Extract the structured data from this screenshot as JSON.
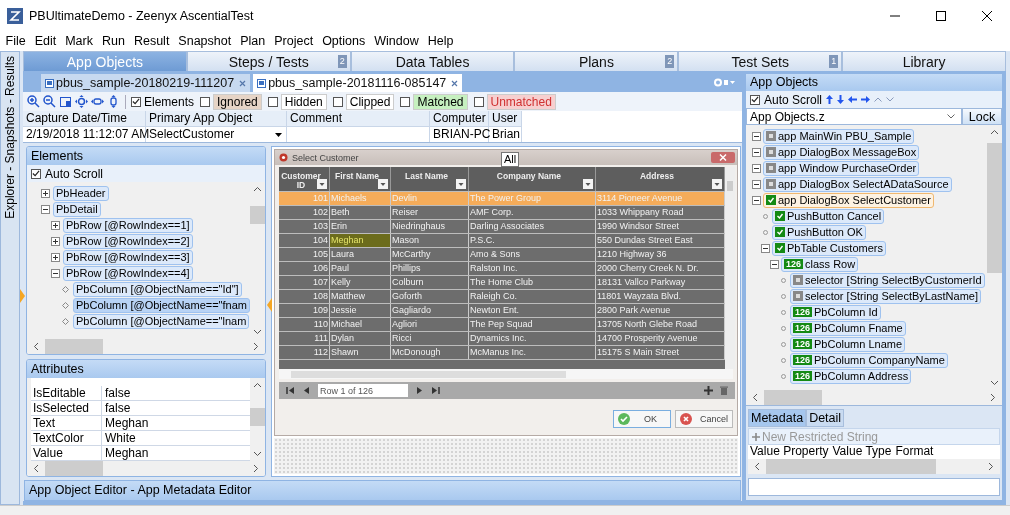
{
  "window": {
    "title": "PBUltimateDemo - Zeenyx AscentialTest"
  },
  "menu": [
    "File",
    "Edit",
    "Mark",
    "Run",
    "Result",
    "Snapshot",
    "Plan",
    "Project",
    "Options",
    "Window",
    "Help"
  ],
  "side_strip": {
    "label": "Explorer - Snapshots - Results"
  },
  "main_tabs": [
    {
      "label": "App Objects",
      "selected": true
    },
    {
      "label": "Steps / Tests",
      "selected": false,
      "badge": "2"
    },
    {
      "label": "Data Tables",
      "selected": false
    },
    {
      "label": "Plans",
      "selected": false,
      "badge": "2"
    },
    {
      "label": "Test Sets",
      "selected": false,
      "badge": "1"
    },
    {
      "label": "Library",
      "selected": false
    }
  ],
  "doc_tabs": [
    {
      "label": "pbus_sample-20180219-111207",
      "selected": false
    },
    {
      "label": "pbus_sample-20181116-085147",
      "selected": true
    }
  ],
  "filters": [
    {
      "label": "Elements",
      "checked": true
    },
    {
      "label": "Ignored",
      "checked": false,
      "color": "#e6d4c6"
    },
    {
      "label": "Hidden",
      "checked": false,
      "color": "#ffffff"
    },
    {
      "label": "Clipped",
      "checked": false,
      "color": "#ffffff"
    },
    {
      "label": "Matched",
      "checked": false,
      "color": "#c6f0c0"
    },
    {
      "label": "Unmatched",
      "checked": false,
      "color": "#f7d0d0"
    }
  ],
  "snapshot_info": [
    {
      "label": "Capture Date/Time",
      "value": "2/19/2018 11:12:07 AM",
      "kind": "text"
    },
    {
      "label": "Primary App Object",
      "value": "SelectCustomer",
      "kind": "dropdown"
    },
    {
      "label": "Comment",
      "kind": "text"
    },
    {
      "label": "Computer",
      "value": "BRIAN-PC",
      "kind": "text"
    },
    {
      "label": "User",
      "value": "Brian",
      "kind": "text"
    }
  ],
  "elements_panel": {
    "title": "Elements",
    "auto_scroll": {
      "label": "Auto Scroll",
      "checked": true
    },
    "tree": [
      {
        "label": "PbHeader",
        "expanded": false,
        "selected": false
      },
      {
        "label": "PbDetail",
        "expanded": true,
        "selected": false,
        "children": [
          {
            "label": "PbRow [@RowIndex==1]",
            "expanded": false,
            "selected": false
          },
          {
            "label": "PbRow [@RowIndex==2]",
            "expanded": false,
            "selected": false
          },
          {
            "label": "PbRow [@RowIndex==3]",
            "expanded": false,
            "selected": false
          },
          {
            "label": "PbRow [@RowIndex==4]",
            "expanded": true,
            "selected": false,
            "children": [
              {
                "label": "PbColumn [@ObjectName==\"Id\"]",
                "selected": false
              },
              {
                "label": "PbColumn [@ObjectName==\"fnam",
                "selected": true
              },
              {
                "label": "PbColumn [@ObjectName==\"lnam",
                "selected": false
              }
            ]
          }
        ]
      }
    ]
  },
  "attributes_panel": {
    "title": "Attributes",
    "rows": [
      {
        "name": "IsEditable",
        "value": "false"
      },
      {
        "name": "IsSelected",
        "value": "false"
      },
      {
        "name": "Text",
        "value": "Meghan"
      },
      {
        "name": "TextColor",
        "value": "White"
      },
      {
        "name": "Value",
        "value": "Meghan"
      }
    ]
  },
  "screenshot": {
    "title": "Select Customer",
    "tooltip": "All",
    "columns": [
      "Customer ID",
      "First Name",
      "Last Name",
      "Company Name",
      "Address"
    ],
    "rows": [
      {
        "selected": true,
        "cells": [
          {
            "text": "101",
            "marked": false
          },
          {
            "text": "Michaels",
            "marked": false
          },
          {
            "text": "Devlin",
            "marked": false
          },
          {
            "text": "The Power Group",
            "marked": false
          },
          {
            "text": "3114 Pioneer Avenue",
            "marked": false
          }
        ]
      },
      {
        "selected": false,
        "cells": [
          {
            "text": "102",
            "marked": false
          },
          {
            "text": "Beth",
            "marked": false
          },
          {
            "text": "Reiser",
            "marked": false
          },
          {
            "text": "AMF Corp.",
            "marked": false
          },
          {
            "text": "1033 Whippany Road",
            "marked": false
          }
        ]
      },
      {
        "selected": false,
        "cells": [
          {
            "text": "103",
            "marked": false
          },
          {
            "text": "Erin",
            "marked": false
          },
          {
            "text": "Niedringhaus",
            "marked": false
          },
          {
            "text": "Darling Associates",
            "marked": false
          },
          {
            "text": "1990 Windsor Street",
            "marked": false
          }
        ]
      },
      {
        "selected": false,
        "cells": [
          {
            "text": "104",
            "marked": false
          },
          {
            "text": "Meghan",
            "marked": true
          },
          {
            "text": "Mason",
            "marked": false
          },
          {
            "text": "P.S.C.",
            "marked": false
          },
          {
            "text": "550 Dundas Street East",
            "marked": false
          }
        ]
      },
      {
        "selected": false,
        "cells": [
          {
            "text": "105",
            "marked": false
          },
          {
            "text": "Laura",
            "marked": false
          },
          {
            "text": "McCarthy",
            "marked": false
          },
          {
            "text": "Amo & Sons",
            "marked": false
          },
          {
            "text": "1210 Highway 36",
            "marked": false
          }
        ]
      },
      {
        "selected": false,
        "cells": [
          {
            "text": "106",
            "marked": false
          },
          {
            "text": "Paul",
            "marked": false
          },
          {
            "text": "Phillips",
            "marked": false
          },
          {
            "text": "Ralston Inc.",
            "marked": false
          },
          {
            "text": "2000 Cherry Creek N. Dr.",
            "marked": false
          }
        ]
      },
      {
        "selected": false,
        "cells": [
          {
            "text": "107",
            "marked": false
          },
          {
            "text": "Kelly",
            "marked": false
          },
          {
            "text": "Colburn",
            "marked": false
          },
          {
            "text": "The Home Club",
            "marked": false
          },
          {
            "text": "18131 Vallco Parkway",
            "marked": false
          }
        ]
      },
      {
        "selected": false,
        "cells": [
          {
            "text": "108",
            "marked": false
          },
          {
            "text": "Matthew",
            "marked": false
          },
          {
            "text": "Goforth",
            "marked": false
          },
          {
            "text": "Raleigh Co.",
            "marked": false
          },
          {
            "text": "11801 Wayzata Blvd.",
            "marked": false
          }
        ]
      },
      {
        "selected": false,
        "cells": [
          {
            "text": "109",
            "marked": false
          },
          {
            "text": "Jessie",
            "marked": false
          },
          {
            "text": "Gagliardo",
            "marked": false
          },
          {
            "text": "Newton Ent.",
            "marked": false
          },
          {
            "text": "2800 Park Avenue",
            "marked": false
          }
        ]
      },
      {
        "selected": false,
        "cells": [
          {
            "text": "110",
            "marked": false
          },
          {
            "text": "Michael",
            "marked": false
          },
          {
            "text": "Agliori",
            "marked": false
          },
          {
            "text": "The Pep Squad",
            "marked": false
          },
          {
            "text": "13705 North Glebe Road",
            "marked": false
          }
        ]
      },
      {
        "selected": false,
        "cells": [
          {
            "text": "111",
            "marked": false
          },
          {
            "text": "Dylan",
            "marked": false
          },
          {
            "text": "Ricci",
            "marked": false
          },
          {
            "text": "Dynamics Inc.",
            "marked": false
          },
          {
            "text": "14700 Prosperity Avenue",
            "marked": false
          }
        ]
      },
      {
        "selected": false,
        "cells": [
          {
            "text": "112",
            "marked": false
          },
          {
            "text": "Shawn",
            "marked": false
          },
          {
            "text": "McDonough",
            "marked": false
          },
          {
            "text": "McManus Inc.",
            "marked": false
          },
          {
            "text": "15175 S Main Street",
            "marked": false
          }
        ]
      }
    ],
    "pager": {
      "value": "Row 1 of 126"
    },
    "buttons": [
      {
        "label": "OK",
        "kind": "ok"
      },
      {
        "label": "Cancel",
        "kind": "cancel"
      }
    ]
  },
  "bottom_bar": {
    "label": "App Object Editor - App Metadata Editor"
  },
  "right_panel": {
    "title": "App Objects",
    "auto_scroll": {
      "label": "Auto Scroll",
      "checked": true
    },
    "file": {
      "value": "App Objects.z"
    },
    "lock_button": "Lock",
    "tree": [
      {
        "label": "app MainWin PBU_Sample",
        "kind": "plain",
        "expanded": true,
        "selected": false
      },
      {
        "label": "app DialogBox MessageBox",
        "kind": "plain",
        "expanded": true,
        "selected": false
      },
      {
        "label": "app Window PurchaseOrder",
        "kind": "plain",
        "expanded": true,
        "selected": false
      },
      {
        "label": "app DialogBox SelectADataSource",
        "kind": "plain",
        "expanded": true,
        "selected": false
      },
      {
        "label": "app DialogBox SelectCustomer",
        "kind": "check",
        "expanded": true,
        "selected": true,
        "children": [
          {
            "label": "PushButton Cancel",
            "kind": "check",
            "selected": false
          },
          {
            "label": "PushButton OK",
            "kind": "check",
            "selected": false
          },
          {
            "label": "PbTable Customers",
            "kind": "check",
            "expanded": true,
            "selected": false,
            "children": [
              {
                "label": "class Row",
                "kind": "count",
                "badge": "126",
                "expanded": true,
                "selected": false,
                "children": [
                  {
                    "label": "selector [String SelectByCustomerId",
                    "kind": "plain",
                    "selected": false
                  },
                  {
                    "label": "selector [String SelectByLastName]",
                    "kind": "plain",
                    "selected": false
                  },
                  {
                    "label": "PbColumn Id",
                    "kind": "count",
                    "badge": "126",
                    "selected": false
                  },
                  {
                    "label": "PbColumn Fname",
                    "kind": "count",
                    "badge": "126",
                    "selected": false
                  },
                  {
                    "label": "PbColumn Lname",
                    "kind": "count",
                    "badge": "126",
                    "selected": false
                  },
                  {
                    "label": "PbColumn CompanyName",
                    "kind": "count",
                    "badge": "126",
                    "selected": false
                  },
                  {
                    "label": "PbColumn Address",
                    "kind": "count",
                    "badge": "126",
                    "selected": false
                  }
                ]
              }
            ]
          }
        ]
      }
    ],
    "tabs": [
      {
        "label": "Metadata",
        "selected": true
      },
      {
        "label": "Detail",
        "selected": false
      }
    ],
    "new_button": {
      "label": "New Restricted String",
      "disabled": true
    },
    "columns": [
      "Value Property",
      "Value Type",
      "Format"
    ]
  }
}
